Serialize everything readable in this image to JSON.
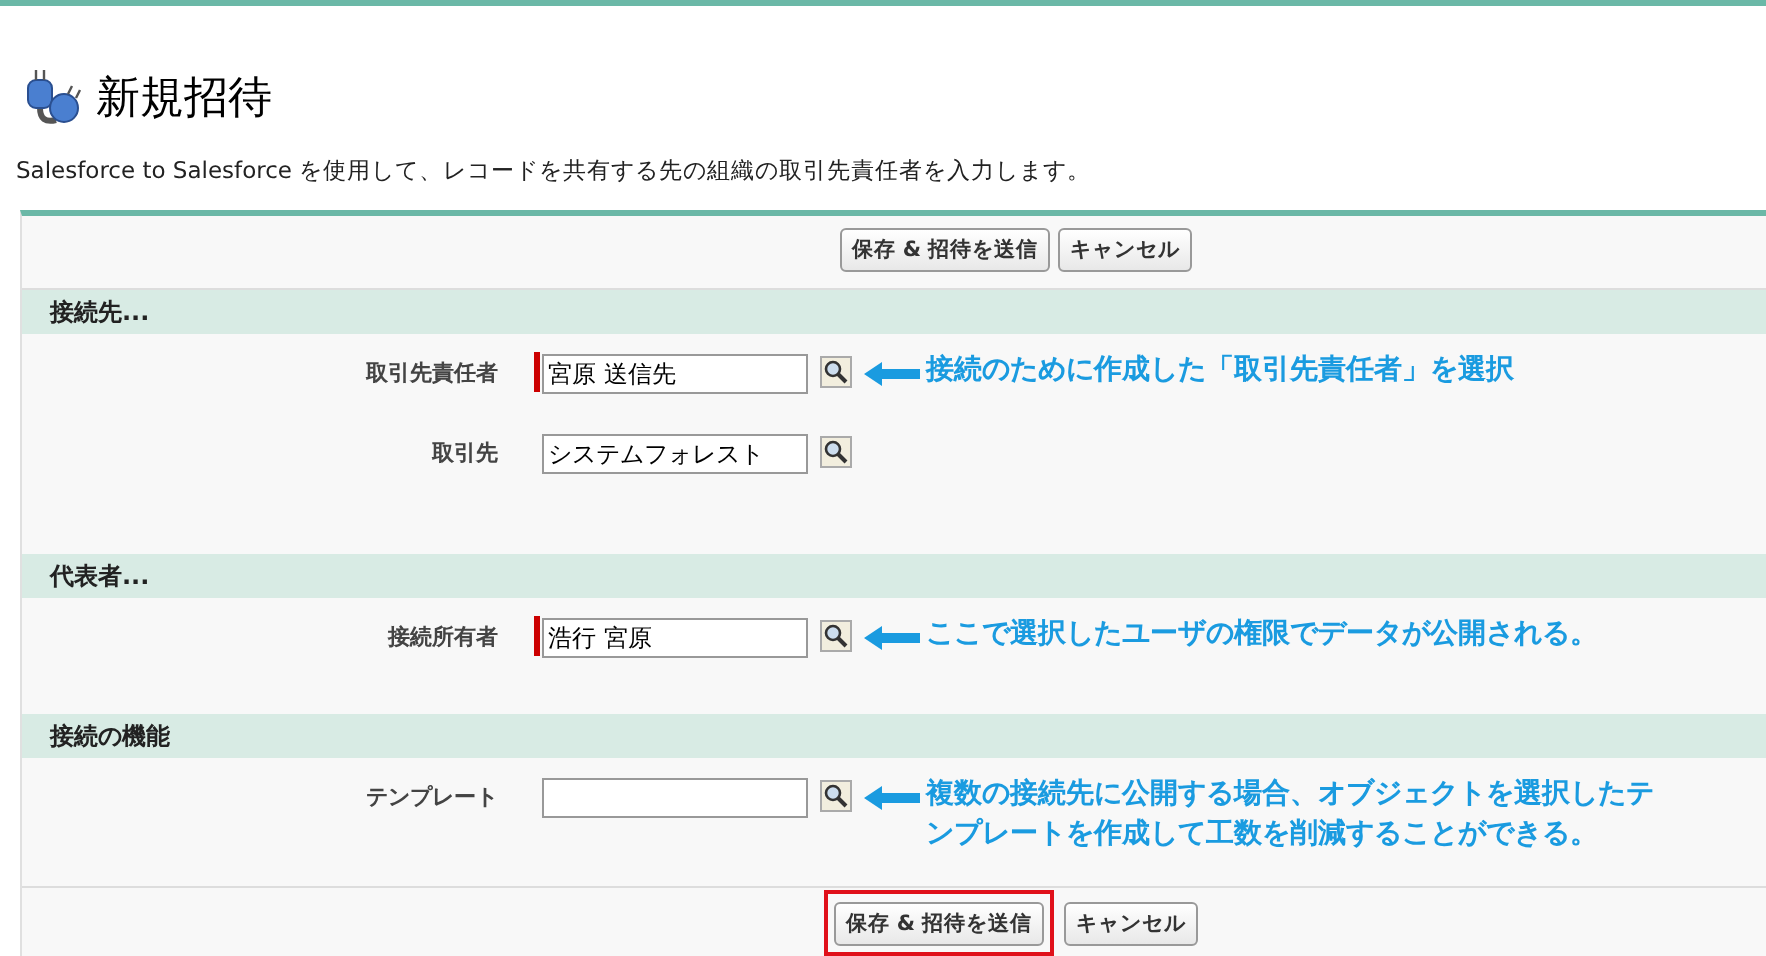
{
  "title": "新規招待",
  "description": "Salesforce to Salesforce を使用して、レコードを共有する先の組織の取引先責任者を入力します。",
  "top_buttons": [
    {
      "label": "保存 & 招待を送信",
      "highlighted": false
    },
    {
      "label": "キャンセル",
      "highlighted": false
    }
  ],
  "sections": [
    {
      "title": "接続先...",
      "fields": [
        {
          "label": "取引先責任者",
          "value": "宮原 送信先",
          "required": true,
          "annotation": [
            "接続のために作成した「取引先責任者」を選択"
          ]
        },
        {
          "label": "取引先",
          "value": "システムフォレスト",
          "required": false
        }
      ]
    },
    {
      "title": "代表者...",
      "fields": [
        {
          "label": "接続所有者",
          "value": "浩行 宮原",
          "required": true,
          "annotation": [
            "ここで選択したユーザの権限でデータが公開される。"
          ]
        }
      ]
    },
    {
      "title": "接続の機能",
      "fields": [
        {
          "label": "テンプレート",
          "required": false,
          "annotation": [
            "複数の接続先に公開する場合、オブジェクトを選択したテ",
            "ンプレートを作成して工数を削減することができる。"
          ]
        }
      ]
    }
  ],
  "bottom_buttons": [
    {
      "label": "保存 & 招待を送信",
      "highlighted": true
    },
    {
      "label": "キャンセル",
      "highlighted": false
    }
  ]
}
